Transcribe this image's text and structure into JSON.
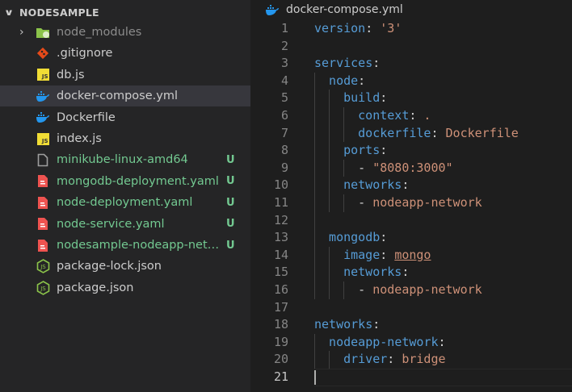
{
  "explorer": {
    "title": "NODESAMPLE",
    "items": [
      {
        "name": "node_modules",
        "icon": "folder-icon",
        "type": "folder",
        "color": "#8c8c8c",
        "badge": ""
      },
      {
        "name": ".gitignore",
        "icon": "git-icon",
        "type": "file",
        "color": "#cccccc",
        "badge": ""
      },
      {
        "name": "db.js",
        "icon": "js-icon",
        "type": "file",
        "color": "#cccccc",
        "badge": ""
      },
      {
        "name": "docker-compose.yml",
        "icon": "docker-icon",
        "type": "file",
        "color": "#cccccc",
        "badge": "",
        "selected": true
      },
      {
        "name": "Dockerfile",
        "icon": "docker-icon",
        "type": "file",
        "color": "#cccccc",
        "badge": ""
      },
      {
        "name": "index.js",
        "icon": "js-icon",
        "type": "file",
        "color": "#cccccc",
        "badge": ""
      },
      {
        "name": "minikube-linux-amd64",
        "icon": "file-icon",
        "type": "file",
        "color": "#73c991",
        "badge": "U"
      },
      {
        "name": "mongodb-deployment.yaml",
        "icon": "yaml-icon",
        "type": "file",
        "color": "#73c991",
        "badge": "U"
      },
      {
        "name": "node-deployment.yaml",
        "icon": "yaml-icon",
        "type": "file",
        "color": "#73c991",
        "badge": "U"
      },
      {
        "name": "node-service.yaml",
        "icon": "yaml-icon",
        "type": "file",
        "color": "#73c991",
        "badge": "U"
      },
      {
        "name": "nodesample-nodeapp-net…",
        "icon": "yaml-icon",
        "type": "file",
        "color": "#73c991",
        "badge": "U"
      },
      {
        "name": "package-lock.json",
        "icon": "nodejs-icon",
        "type": "file",
        "color": "#cccccc",
        "badge": ""
      },
      {
        "name": "package.json",
        "icon": "nodejs-icon",
        "type": "file",
        "color": "#cccccc",
        "badge": ""
      }
    ]
  },
  "editor": {
    "tab_title": "docker-compose.yml",
    "current_line": 21,
    "lines": [
      {
        "n": "1",
        "indent": 0,
        "key": "version",
        "val": "'3'"
      },
      {
        "n": "2",
        "indent": 0
      },
      {
        "n": "3",
        "indent": 0,
        "key": "services"
      },
      {
        "n": "4",
        "indent": 1,
        "key": "node"
      },
      {
        "n": "5",
        "indent": 2,
        "key": "build"
      },
      {
        "n": "6",
        "indent": 3,
        "key": "context",
        "val": "."
      },
      {
        "n": "7",
        "indent": 3,
        "key": "dockerfile",
        "val": "Dockerfile"
      },
      {
        "n": "8",
        "indent": 2,
        "key": "ports"
      },
      {
        "n": "9",
        "indent": 3,
        "dash": true,
        "val": "\"8080:3000\""
      },
      {
        "n": "10",
        "indent": 2,
        "key": "networks"
      },
      {
        "n": "11",
        "indent": 3,
        "dash": true,
        "val": "nodeapp-network"
      },
      {
        "n": "12",
        "indent": 1
      },
      {
        "n": "13",
        "indent": 1,
        "key": "mongodb"
      },
      {
        "n": "14",
        "indent": 2,
        "key": "image",
        "val": "mongo",
        "underline": true
      },
      {
        "n": "15",
        "indent": 2,
        "key": "networks"
      },
      {
        "n": "16",
        "indent": 3,
        "dash": true,
        "val": "nodeapp-network"
      },
      {
        "n": "17",
        "indent": 0
      },
      {
        "n": "18",
        "indent": 0,
        "key": "networks"
      },
      {
        "n": "19",
        "indent": 1,
        "key": "nodeapp-network"
      },
      {
        "n": "20",
        "indent": 2,
        "key": "driver",
        "val": "bridge"
      },
      {
        "n": "21",
        "indent": 0
      }
    ]
  }
}
